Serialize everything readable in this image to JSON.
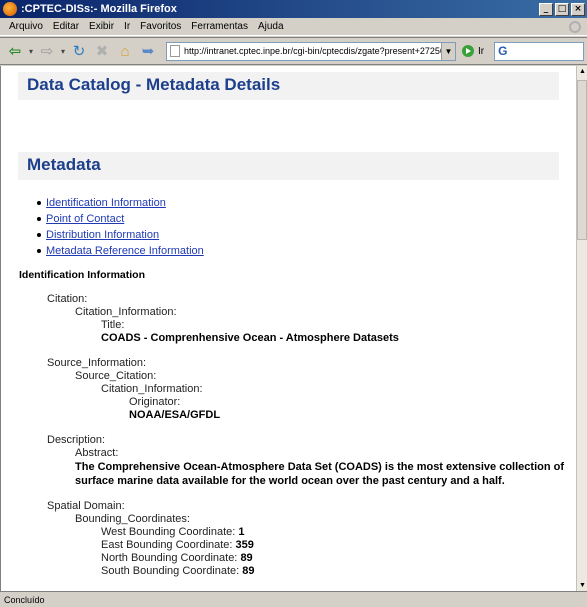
{
  "window": {
    "title": ":CPTEC-DISs:- Mozilla Firefox",
    "min_glyph": "_",
    "max_glyph": "□",
    "close_glyph": "×"
  },
  "menu": [
    "Arquivo",
    "Editar",
    "Exibir",
    "Ir",
    "Favoritos",
    "Ferramentas",
    "Ajuda"
  ],
  "toolbar": {
    "url": "http://intranet.cptec.inpe.br/cgi-bin/cptecdis/zgate?present+27256+Default",
    "go_label": "Ir",
    "icons": {
      "back": "arrow-left-icon",
      "forward": "arrow-right-icon",
      "reload": "reload-icon",
      "stop": "stop-icon",
      "home": "home-icon"
    }
  },
  "page": {
    "title": "Data Catalog - Metadata Details",
    "metadata_heading": "Metadata",
    "toc": [
      "Identification Information",
      "Point of Contact",
      "Distribution Information",
      "Metadata Reference Information"
    ],
    "section_title": "Identification Information",
    "citation": {
      "label": "Citation:",
      "info_label": "Citation_Information:",
      "title_label": "Title:",
      "title_value": "COADS - Comprenhensive Ocean - Atmosphere Datasets"
    },
    "source": {
      "label": "Source_Information:",
      "source_citation_label": "Source_Citation:",
      "info_label": "Citation_Information:",
      "originator_label": "Originator:",
      "originator_value": "NOAA/ESA/GFDL"
    },
    "description": {
      "label": "Description:",
      "abstract_label": "Abstract:",
      "abstract_value": "The Comprehensive Ocean-Atmosphere Data Set (COADS) is the most extensive collection of surface marine data available for the world ocean over the past century and a half."
    },
    "spatial": {
      "label": "Spatial Domain:",
      "bounding_label": "Bounding_Coordinates:",
      "west_label": "West Bounding Coordinate:",
      "west_value": "1",
      "east_label": "East Bounding Coordinate:",
      "east_value": "359",
      "north_label": "North Bounding Coordinate:",
      "north_value": "89",
      "south_label": "South Bounding Coordinate:",
      "south_value": "89"
    }
  },
  "status": "Concluído"
}
